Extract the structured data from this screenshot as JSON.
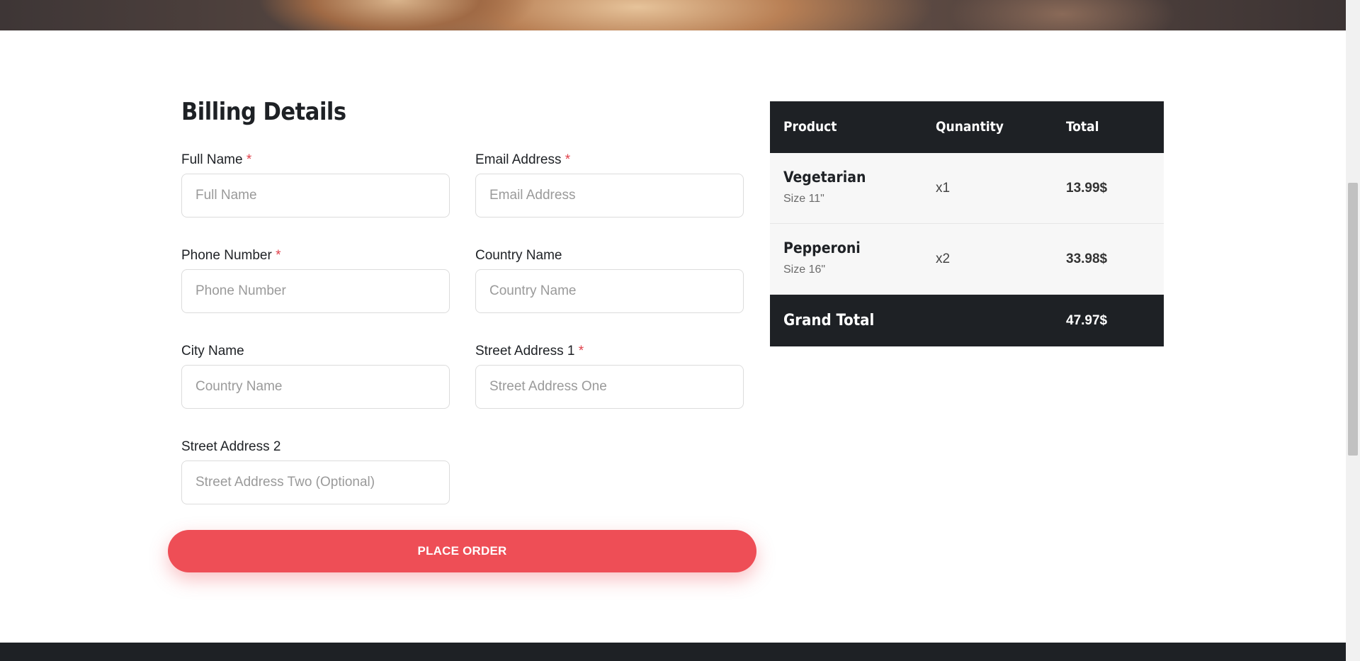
{
  "billing": {
    "title": "Billing Details",
    "required_marker": "*",
    "fields": [
      {
        "label": "Full Name",
        "required": true,
        "placeholder": "Full Name",
        "value": ""
      },
      {
        "label": "Email Address",
        "required": true,
        "placeholder": "Email Address",
        "value": ""
      },
      {
        "label": "Phone Number",
        "required": true,
        "placeholder": "Phone Number",
        "value": ""
      },
      {
        "label": "Country Name",
        "required": false,
        "placeholder": "Country Name",
        "value": ""
      },
      {
        "label": "City Name",
        "required": false,
        "placeholder": "Country Name",
        "value": ""
      },
      {
        "label": "Street Address 1",
        "required": true,
        "placeholder": "Street Address One",
        "value": ""
      },
      {
        "label": "Street Address 2",
        "required": false,
        "placeholder": "Street Address Two (Optional)",
        "value": ""
      }
    ],
    "submit_label": "PLACE ORDER"
  },
  "order": {
    "headers": {
      "product": "Product",
      "quantity": "Qunantity",
      "total": "Total"
    },
    "items": [
      {
        "name": "Vegetarian",
        "size": "Size 11\"",
        "quantity": "x1",
        "total": "13.99$"
      },
      {
        "name": "Pepperoni",
        "size": "Size 16\"",
        "quantity": "x2",
        "total": "33.98$"
      }
    ],
    "grand_total_label": "Grand Total",
    "grand_total_value": "47.97$"
  },
  "colors": {
    "accent": "#ee4e56",
    "dark": "#1e2125",
    "required": "#e0404a",
    "row_bg": "#f7f7f7"
  }
}
